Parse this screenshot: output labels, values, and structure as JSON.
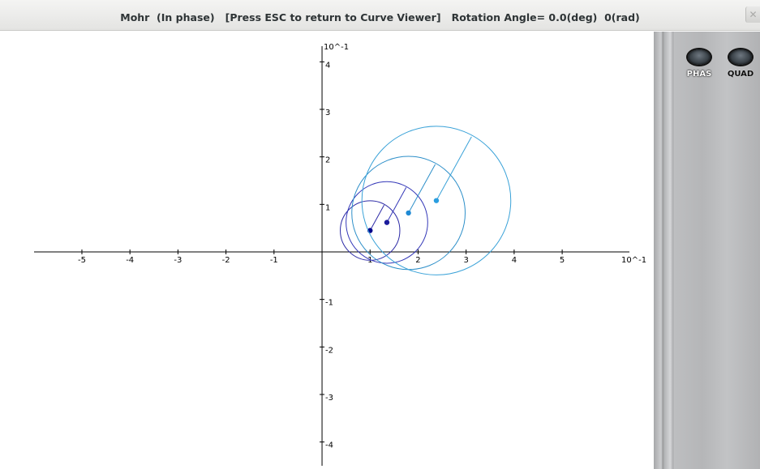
{
  "window": {
    "title": "Mohr  (In phase)   [Press ESC to return to Curve Viewer]   Rotation Angle= 0.0(deg)  0(rad)",
    "close_glyph": "✕"
  },
  "side_panel": {
    "buttons": [
      {
        "label": "PHAS",
        "icon": "oval-knob-icon"
      },
      {
        "label": "QUAD",
        "icon": "oval-knob-icon"
      }
    ]
  },
  "colors": {
    "axis": "#000000",
    "circle_1": "#2c2aa6",
    "circle_2": "#3438b8",
    "circle_3": "#2d8fc9",
    "circle_4": "#3aa2d8",
    "center_1": "#00008b",
    "center_2": "#1c1c9c",
    "center_3": "#1f8ad4",
    "center_4": "#2a9ee0"
  },
  "chart_data": {
    "type": "scatter",
    "x_multiplier_label": "10^-1",
    "y_multiplier_label": "10^-1",
    "xlim": [
      -6.3,
      6.4
    ],
    "ylim": [
      -4.5,
      4.5
    ],
    "x_ticks": [
      -5,
      -4,
      -3,
      -2,
      -1,
      1,
      2,
      3,
      4,
      5
    ],
    "y_ticks": [
      -4,
      -3,
      -2,
      -1,
      1,
      2,
      3,
      4
    ],
    "grid": false,
    "circles": [
      {
        "cx": 1.0,
        "cy": 0.45,
        "r": 0.62,
        "color_key": "circle_1",
        "center_color_key": "center_1"
      },
      {
        "cx": 1.35,
        "cy": 0.62,
        "r": 0.85,
        "color_key": "circle_2",
        "center_color_key": "center_2"
      },
      {
        "cx": 1.8,
        "cy": 0.82,
        "r": 1.18,
        "color_key": "circle_3",
        "center_color_key": "center_3"
      },
      {
        "cx": 2.38,
        "cy": 1.08,
        "r": 1.55,
        "color_key": "circle_4",
        "center_color_key": "center_4"
      }
    ]
  }
}
